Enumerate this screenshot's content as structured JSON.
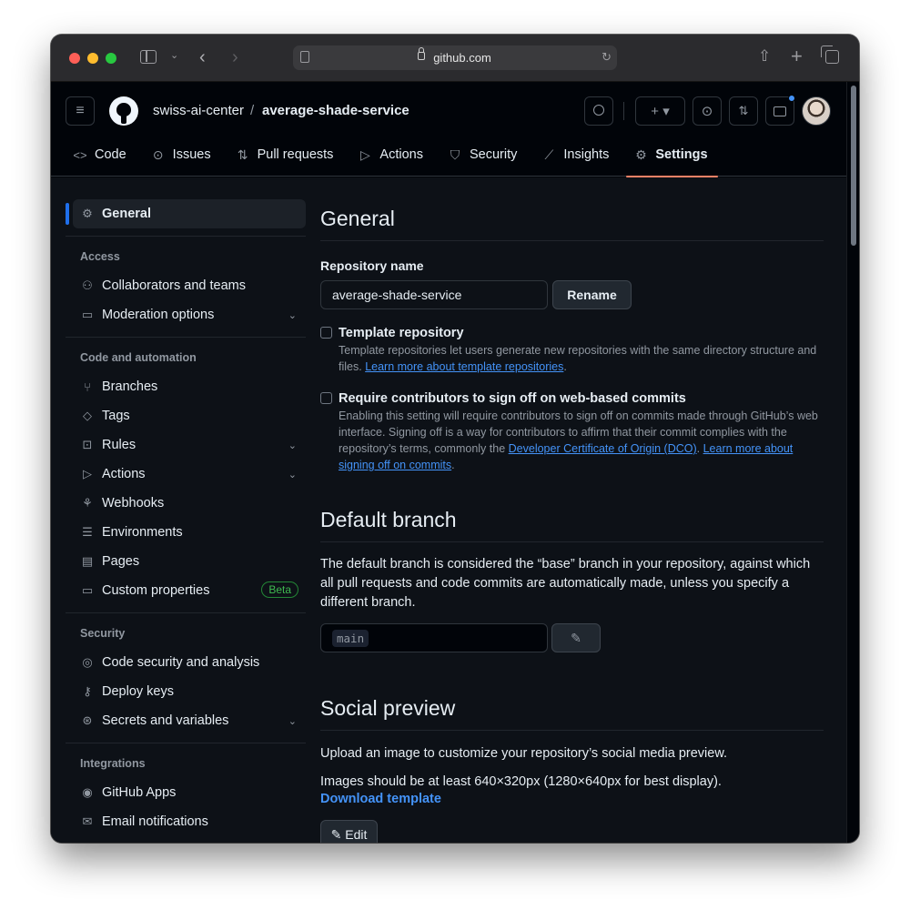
{
  "browser": {
    "url": "github.com"
  },
  "header": {
    "owner": "swiss-ai-center",
    "separator": "/",
    "repo": "average-shade-service",
    "add_button_label": "+ ▾"
  },
  "tabs": [
    {
      "label": "Code",
      "icon": "code-icon",
      "glyph": "<>"
    },
    {
      "label": "Issues",
      "icon": "issue-icon",
      "glyph": "⊙"
    },
    {
      "label": "Pull requests",
      "icon": "pull-request-icon",
      "glyph": "⇅"
    },
    {
      "label": "Actions",
      "icon": "play-icon",
      "glyph": "▷"
    },
    {
      "label": "Security",
      "icon": "shield-icon",
      "glyph": "⛉"
    },
    {
      "label": "Insights",
      "icon": "graph-icon",
      "glyph": "⟋"
    },
    {
      "label": "Settings",
      "icon": "gear-icon",
      "glyph": "⚙"
    }
  ],
  "sidebar": {
    "general": "General",
    "access_heading": "Access",
    "access_items": [
      {
        "label": "Collaborators and teams",
        "icon": "people-icon"
      },
      {
        "label": "Moderation options",
        "icon": "comment-icon"
      }
    ],
    "code_heading": "Code and automation",
    "code_items": [
      {
        "label": "Branches",
        "icon": "branch-icon"
      },
      {
        "label": "Tags",
        "icon": "tag-icon"
      },
      {
        "label": "Rules",
        "icon": "rules-icon"
      },
      {
        "label": "Actions",
        "icon": "play-icon"
      },
      {
        "label": "Webhooks",
        "icon": "webhook-icon"
      },
      {
        "label": "Environments",
        "icon": "server-icon"
      },
      {
        "label": "Pages",
        "icon": "browser-icon"
      },
      {
        "label": "Custom properties",
        "icon": "note-icon"
      }
    ],
    "beta_label": "Beta",
    "security_heading": "Security",
    "security_items": [
      {
        "label": "Code security and analysis",
        "icon": "codescan-icon"
      },
      {
        "label": "Deploy keys",
        "icon": "key-icon"
      },
      {
        "label": "Secrets and variables",
        "icon": "asterisk-icon"
      }
    ],
    "integrations_heading": "Integrations",
    "integration_items": [
      {
        "label": "GitHub Apps",
        "icon": "apps-icon"
      },
      {
        "label": "Email notifications",
        "icon": "mail-icon"
      }
    ]
  },
  "main": {
    "title": "General",
    "repo_name_label": "Repository name",
    "repo_name_value": "average-shade-service",
    "rename_button": "Rename",
    "template": {
      "title": "Template repository",
      "desc": "Template repositories let users generate new repositories with the same directory structure and files. ",
      "link": "Learn more about template repositories",
      "end": "."
    },
    "signoff": {
      "title": "Require contributors to sign off on web-based commits",
      "desc": "Enabling this setting will require contributors to sign off on commits made through GitHub’s web interface. Signing off is a way for contributors to affirm that their commit complies with the repository’s terms, commonly the ",
      "link1": "Developer Certificate of Origin (DCO)",
      "mid": ". ",
      "link2": "Learn more about signing off on commits",
      "end": "."
    },
    "default_branch_title": "Default branch",
    "default_branch_desc": "The default branch is considered the “base” branch in your repository, against which all pull requests and code commits are automatically made, unless you specify a different branch.",
    "default_branch_value": "main",
    "social_title": "Social preview",
    "social_desc": "Upload an image to customize your repository’s social media preview.",
    "social_size": "Images should be at least 640×320px (1280×640px for best display).",
    "download_template": "Download template",
    "edit_button": "Edit"
  }
}
